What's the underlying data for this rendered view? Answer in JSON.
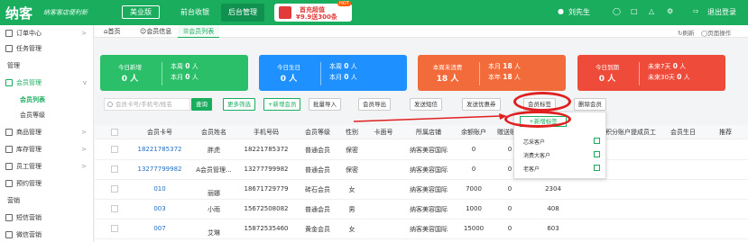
{
  "brand": {
    "logo": "纳客",
    "slogan": "纳客客店便利新"
  },
  "top_nav": {
    "version": "美业版",
    "tabs": [
      "前台收银",
      "后台管理"
    ],
    "promo_line1": "首充超值",
    "promo_line2": "¥9.9送300条",
    "promo_hot": "HOT",
    "user": "刘先生",
    "logout": "退出登录"
  },
  "sidebar": {
    "items": [
      {
        "label": "订单中心",
        "arrow": ">"
      },
      {
        "label": "任务管理",
        "arrow": ""
      }
    ],
    "section_manage": "管理",
    "member_mgmt": "会员管理",
    "member_mgmt_arrow": "v",
    "sub_items": [
      "会员列表",
      "会员等级"
    ],
    "items2": [
      {
        "label": "商品管理",
        "arrow": ">"
      },
      {
        "label": "库存管理",
        "arrow": ">"
      },
      {
        "label": "员工管理",
        "arrow": ">"
      },
      {
        "label": "预约管理",
        "arrow": ""
      }
    ],
    "section_marketing": "营销",
    "items3": [
      {
        "label": "短信营销",
        "arrow": ""
      },
      {
        "label": "微信营销",
        "arrow": ""
      }
    ]
  },
  "tabs": {
    "home": "首页",
    "member_info": "会员信息",
    "member_list": "会员列表",
    "refresh": "刷新",
    "page_ops": "页面操作"
  },
  "cards": [
    {
      "title": "今日新增",
      "value": "0 人",
      "r1_label": "本周",
      "r1_value": "0",
      "r1_unit": "人",
      "r2_label": "本月",
      "r2_value": "0",
      "r2_unit": "人",
      "color": "#2bbf6a"
    },
    {
      "title": "今日生日",
      "value": "0 人",
      "r1_label": "本周",
      "r1_value": "0",
      "r1_unit": "人",
      "r2_label": "本月",
      "r2_value": "0",
      "r2_unit": "人",
      "color": "#1e90ff"
    },
    {
      "title": "本周未消费",
      "value": "18 人",
      "r1_label": "本月",
      "r1_value": "18",
      "r1_unit": "人",
      "r2_label": "本年",
      "r2_value": "18",
      "r2_unit": "人",
      "color": "#f26b3a"
    },
    {
      "title": "今日到期",
      "value": "0 人",
      "r1_label": "未来7天",
      "r1_value": "0",
      "r1_unit": "人",
      "r2_label": "未来30天",
      "r2_value": "0",
      "r2_unit": "人",
      "color": "#ee4b3a"
    }
  ],
  "toolbar": {
    "search_placeholder": "会员卡号/手机号/姓名",
    "query": "查询",
    "more_filter": "更多筛选",
    "add_member": "+新增会员",
    "batch_import": "批量导入",
    "export": "会员导出",
    "send_sms": "发送短信",
    "send_coupon": "发送优惠券",
    "member_tags": "会员标签",
    "delete_member": "删除会员"
  },
  "dropdown": {
    "add_tag": "+新增标签",
    "items": [
      "芯采客户",
      "消费大客户",
      "老客户"
    ]
  },
  "table": {
    "headers": [
      "会员卡号",
      "会员姓名",
      "手机号码",
      "会员等级",
      "性别",
      "卡面号",
      "所属店铺",
      "余额账户",
      "赠送账户",
      "积分账户",
      "提成员工",
      "会员生日",
      "推荐"
    ],
    "rows": [
      [
        "18221785372",
        "胖虎",
        "18221785372",
        "普通会员",
        "保密",
        "",
        "纳客美容国际",
        "0",
        "0",
        "",
        "",
        "",
        ""
      ],
      [
        "13277799982",
        "A会员管理...",
        "13277799982",
        "普通会员",
        "保密",
        "",
        "纳客美容国际",
        "0",
        "0",
        "",
        "",
        "",
        ""
      ],
      [
        "010",
        "丽娜",
        "18671729779",
        "砖石会员",
        "女",
        "",
        "纳客美容国际",
        "7000",
        "0",
        "2304",
        "",
        "",
        ""
      ],
      [
        "003",
        "小雨",
        "15672508082",
        "普通会员",
        "男",
        "",
        "纳客美容国际",
        "1000",
        "0",
        "408",
        "",
        "",
        ""
      ],
      [
        "007",
        "艾琳",
        "15872535460",
        "黄金会员",
        "女",
        "",
        "纳客美容国际",
        "15000",
        "0",
        "603",
        "",
        "",
        ""
      ]
    ]
  }
}
